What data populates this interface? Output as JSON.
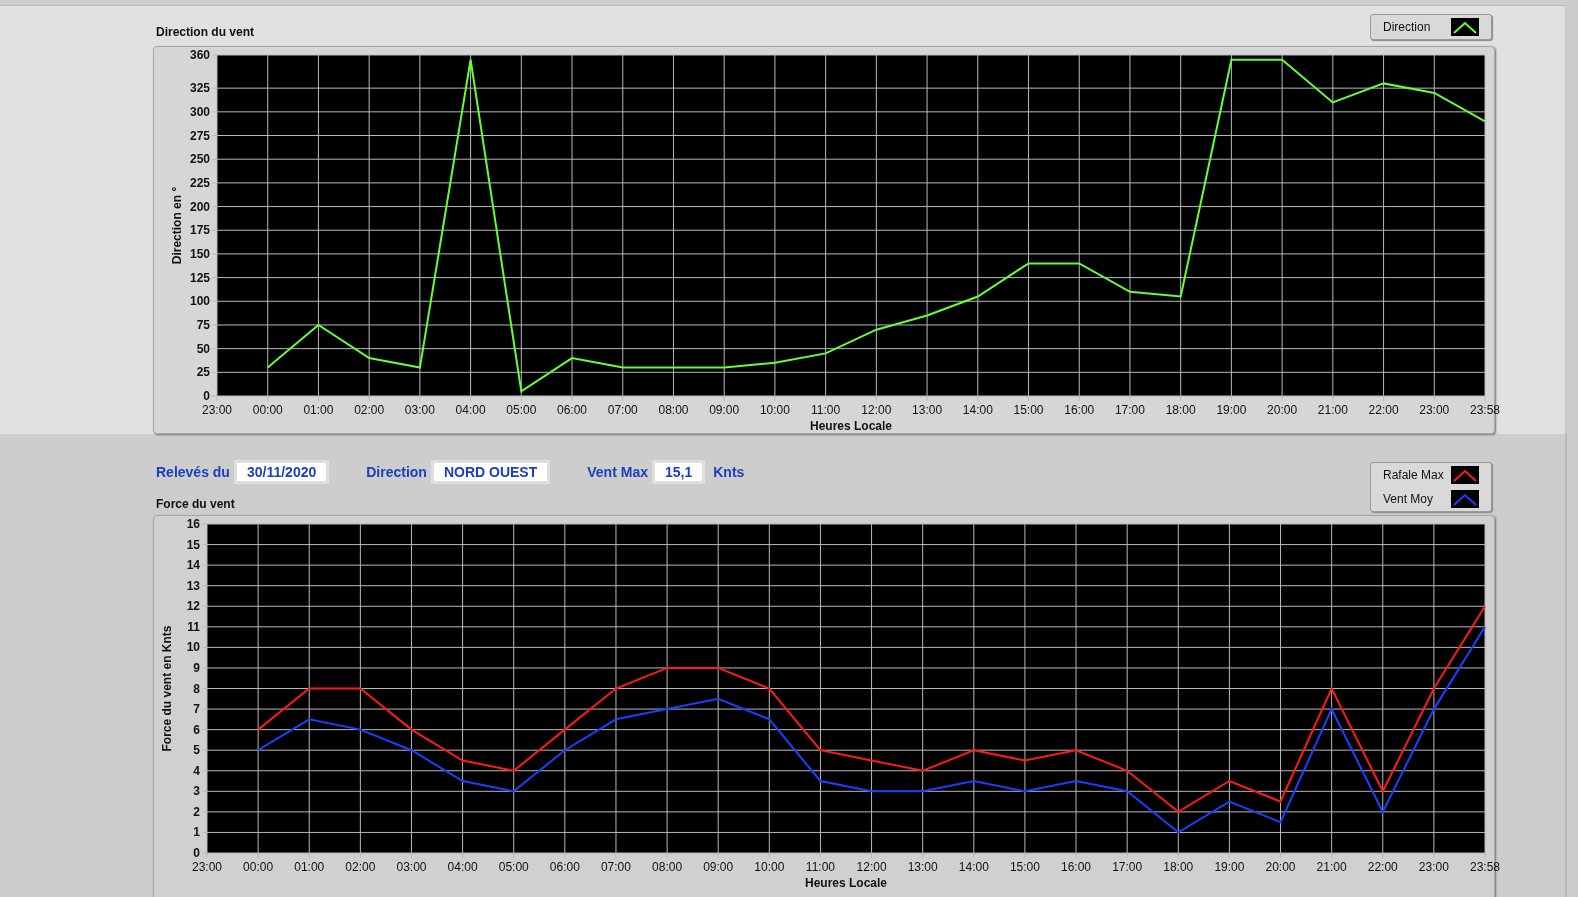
{
  "direction_chart": {
    "title": "Direction du vent",
    "chart_data": {
      "type": "line",
      "grid": true,
      "xlabel": "Heures Locale",
      "ylabel": "Direction en °",
      "ylim": [
        0,
        360
      ],
      "categories": [
        "23:00",
        "00:00",
        "01:00",
        "02:00",
        "03:00",
        "04:00",
        "05:00",
        "06:00",
        "07:00",
        "08:00",
        "09:00",
        "10:00",
        "11:00",
        "12:00",
        "13:00",
        "14:00",
        "15:00",
        "16:00",
        "17:00",
        "18:00",
        "19:00",
        "20:00",
        "21:00",
        "22:00",
        "23:00",
        "23:58"
      ],
      "yticks": [
        0,
        25,
        50,
        75,
        100,
        125,
        150,
        175,
        200,
        225,
        250,
        275,
        300,
        325,
        360
      ],
      "series": [
        {
          "name": "Direction",
          "color": "#66ff33",
          "values": [
            null,
            30,
            75,
            40,
            30,
            355,
            5,
            40,
            30,
            30,
            30,
            35,
            45,
            70,
            85,
            105,
            140,
            140,
            110,
            105,
            355,
            355,
            310,
            330,
            320,
            290
          ]
        }
      ]
    }
  },
  "readings": [
    {
      "label": "Relevés du",
      "value": "30/11/2020"
    },
    {
      "label": "Direction",
      "value": "NORD OUEST"
    },
    {
      "label": "Vent Max",
      "value": "15,1",
      "unit": "Knts"
    }
  ],
  "force_chart": {
    "title": "Force du vent",
    "chart_data": {
      "type": "line",
      "grid": true,
      "xlabel": "Heures Locale",
      "ylabel": "Force du vent en Knts",
      "ylim": [
        0,
        16
      ],
      "categories": [
        "23:00",
        "00:00",
        "01:00",
        "02:00",
        "03:00",
        "04:00",
        "05:00",
        "06:00",
        "07:00",
        "08:00",
        "09:00",
        "10:00",
        "11:00",
        "12:00",
        "13:00",
        "14:00",
        "15:00",
        "16:00",
        "17:00",
        "18:00",
        "19:00",
        "20:00",
        "21:00",
        "22:00",
        "23:00",
        "23:58"
      ],
      "yticks": [
        0,
        1,
        2,
        3,
        4,
        5,
        6,
        7,
        8,
        9,
        10,
        11,
        12,
        13,
        14,
        15,
        16
      ],
      "series": [
        {
          "name": "Rafale Max",
          "color": "#ff1a1a",
          "values": [
            null,
            6,
            8,
            8,
            6,
            4.5,
            4,
            6,
            8,
            9,
            9,
            8,
            5,
            4.5,
            4,
            5,
            4.5,
            5,
            4,
            2,
            3.5,
            2.5,
            8,
            3,
            8,
            12
          ]
        },
        {
          "name": "Vent Moy",
          "color": "#1a3fff",
          "values": [
            null,
            5,
            6.5,
            6,
            5,
            3.5,
            3,
            5,
            6.5,
            7,
            7.5,
            6.5,
            3.5,
            3,
            3,
            3.5,
            3,
            3.5,
            3,
            1,
            2.5,
            1.5,
            7,
            2,
            7,
            11
          ]
        }
      ]
    }
  }
}
